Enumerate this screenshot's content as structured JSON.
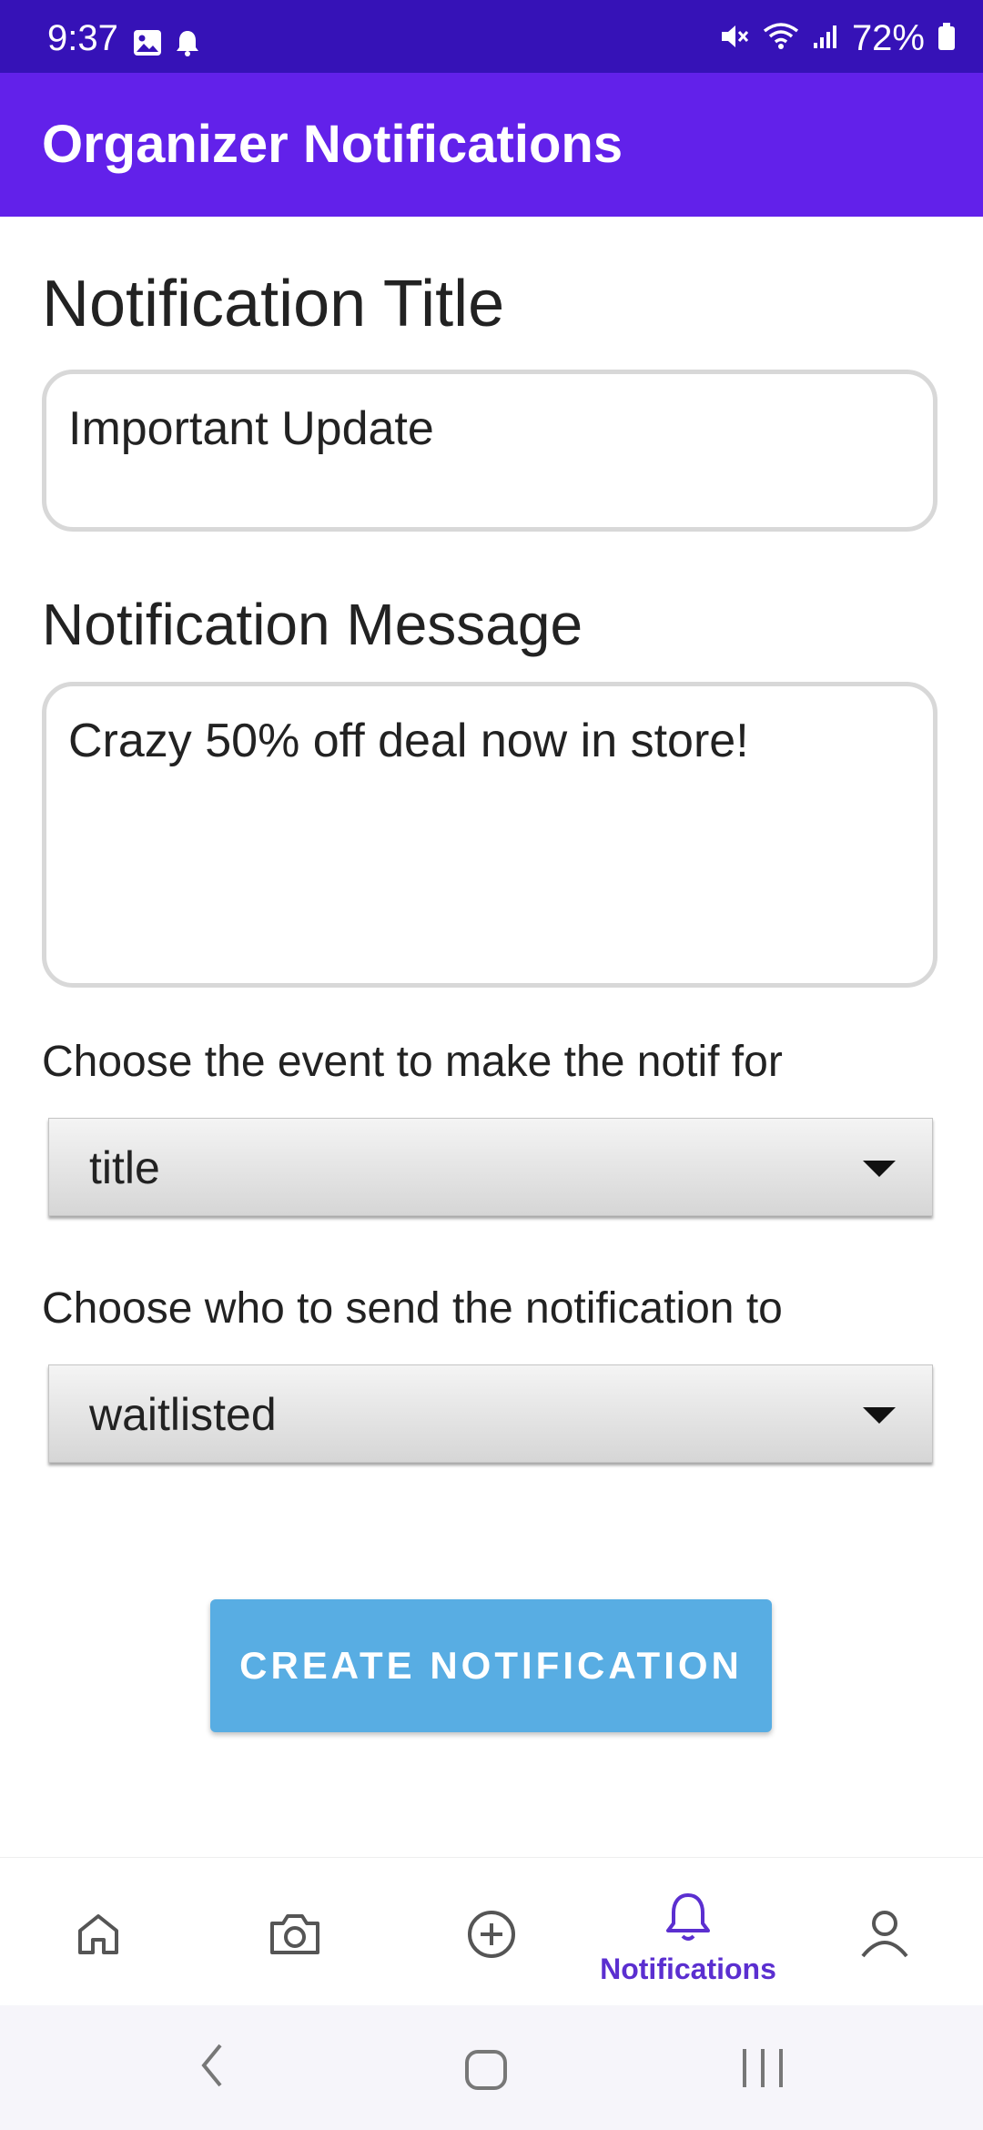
{
  "status_bar": {
    "time": "9:37",
    "battery_percent": "72%",
    "icons": [
      "image-icon",
      "bell-icon",
      "mute-icon",
      "wifi-icon",
      "signal-icon",
      "battery-icon"
    ]
  },
  "app_bar": {
    "title": "Organizer Notifications"
  },
  "form": {
    "title_label": "Notification Title",
    "title_value": "Important Update",
    "message_label": "Notification Message",
    "message_value": "Crazy 50% off deal now in store!",
    "event_label": "Choose the event to make the notif for",
    "event_selected": "title",
    "recipient_label": "Choose who to send the notification to",
    "recipient_selected": "waitlisted",
    "create_button": "CREATE NOTIFICATION"
  },
  "bottom_nav": {
    "items": [
      {
        "icon": "home-icon",
        "label": ""
      },
      {
        "icon": "camera-icon",
        "label": ""
      },
      {
        "icon": "add-circle-icon",
        "label": ""
      },
      {
        "icon": "bell-icon",
        "label": "Notifications",
        "active": true
      },
      {
        "icon": "profile-icon",
        "label": ""
      }
    ]
  },
  "system_nav": {
    "buttons": [
      "back-icon",
      "home-button-icon",
      "recents-icon"
    ]
  },
  "colors": {
    "status_bar": "#3612b7",
    "app_bar": "#6221ea",
    "accent": "#5b2fd0",
    "button": "#58ade3"
  }
}
